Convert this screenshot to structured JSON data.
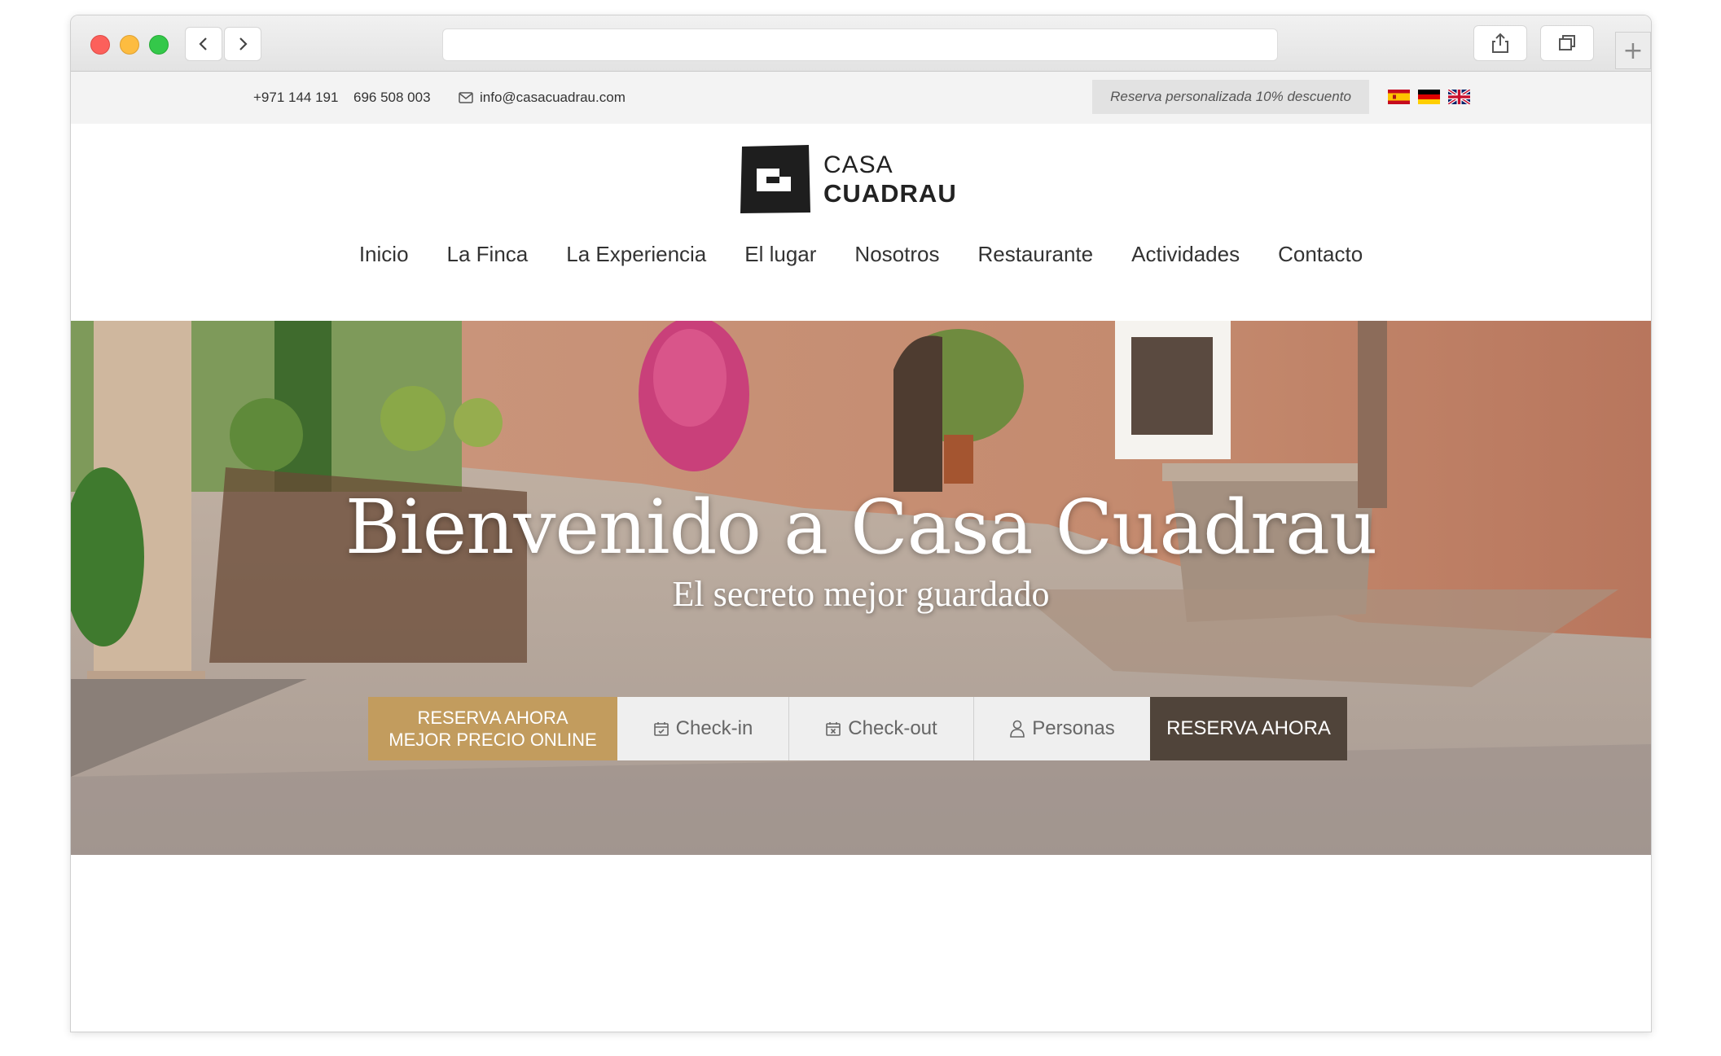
{
  "browser": {
    "url": "",
    "icons": {
      "back": "chevron-left-icon",
      "forward": "chevron-right-icon",
      "share": "share-icon",
      "tabs": "tabs-icon",
      "new_tab": "plus-icon"
    }
  },
  "topbar": {
    "phone1": "+971 144 191",
    "phone2": "696 508 003",
    "email": "info@casacuadrau.com",
    "promo": "Reserva personalizada 10% descuento",
    "flags": [
      "spain-flag-icon",
      "germany-flag-icon",
      "uk-flag-icon"
    ]
  },
  "logo": {
    "line1": "CASA",
    "line2": "CUADRAU"
  },
  "nav": {
    "items": [
      "Inicio",
      "La Finca",
      "La Experiencia",
      "El lugar",
      "Nosotros",
      "Restaurante",
      "Actividades",
      "Contacto"
    ]
  },
  "hero": {
    "title": "Bienvenido a Casa Cuadrau",
    "subtitle": "El secreto mejor guardado"
  },
  "booking": {
    "promo_line1": "RESERVA AHORA",
    "promo_line2": "MEJOR PRECIO ONLINE",
    "checkin": "Check-in",
    "checkout": "Check-out",
    "persons": "Personas",
    "cta": "RESERVA AHORA"
  },
  "colors": {
    "accent_gold": "#c29c5e",
    "cta_dark": "#50443a",
    "topbar_bg": "#f3f3f3"
  }
}
